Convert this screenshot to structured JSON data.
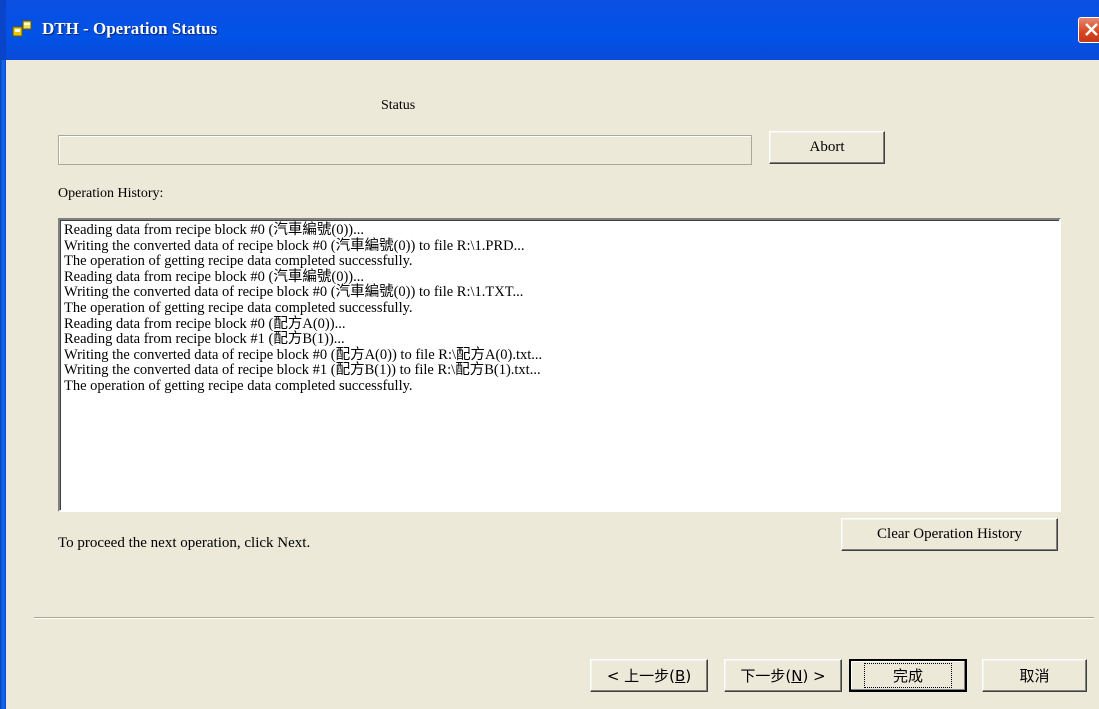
{
  "window": {
    "title": "DTH - Operation Status",
    "colors": {
      "titlebar": "#0152e7",
      "close": "#d6451e",
      "face": "#ece9d8"
    }
  },
  "status": {
    "label": "Status",
    "progress_percent": 0
  },
  "abort_label": "Abort",
  "history": {
    "label": "Operation History:",
    "lines": [
      "Reading data from recipe block #0 (汽車編號(0))...",
      "Writing the converted data of recipe block #0 (汽車編號(0)) to file R:\\1.PRD...",
      "The operation of getting recipe data completed successfully.",
      "Reading data from recipe block #0 (汽車編號(0))...",
      "Writing the converted data of recipe block #0 (汽車編號(0)) to file R:\\1.TXT...",
      "The operation of getting recipe data completed successfully.",
      "Reading data from recipe block #0 (配方A(0))...",
      "Reading data from recipe block #1 (配方B(1))...",
      "Writing the converted data of recipe block #0 (配方A(0)) to file R:\\配方A(0).txt...",
      "Writing the converted data of recipe block #1 (配方B(1)) to file R:\\配方B(1).txt...",
      "The operation of getting recipe data completed successfully."
    ]
  },
  "clear_history_label": "Clear Operation History",
  "hint": "To proceed the next operation, click Next.",
  "nav": {
    "back": {
      "prefix": "< 上一步(",
      "key": "B",
      "suffix": ")"
    },
    "next": {
      "prefix": "下一步(",
      "key": "N",
      "suffix": ") >"
    },
    "finish": "完成",
    "cancel": "取消"
  }
}
